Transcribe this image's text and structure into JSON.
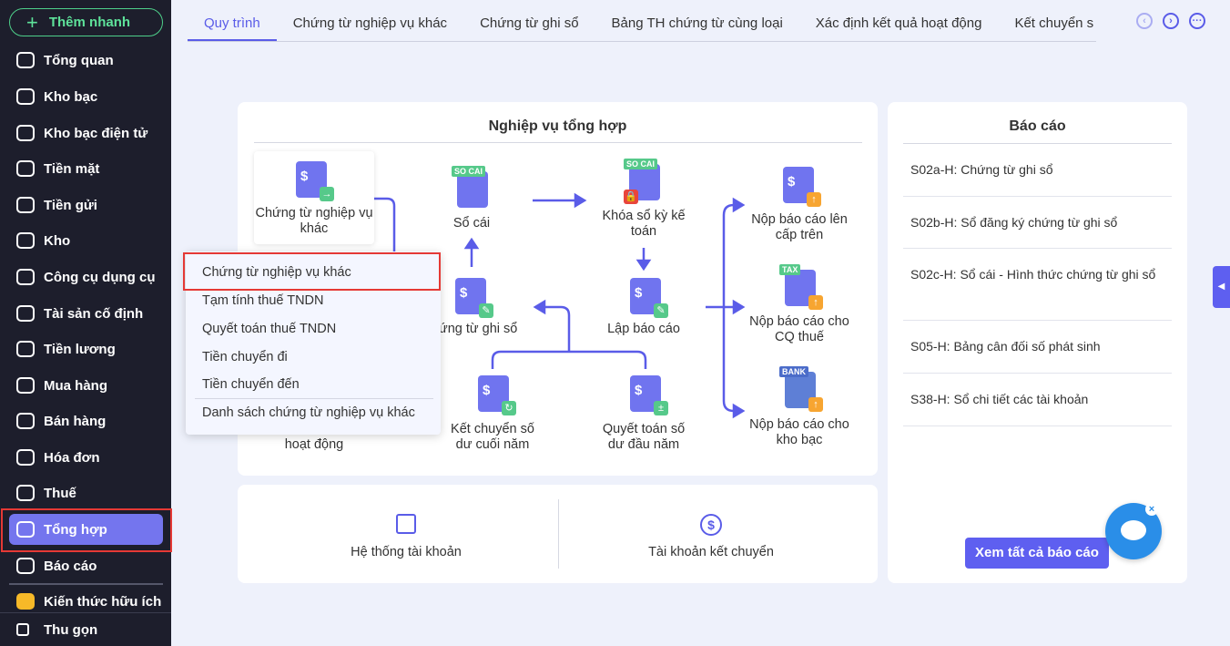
{
  "sidebar": {
    "quick_add": "Thêm nhanh",
    "items": [
      {
        "label": "Tổng quan"
      },
      {
        "label": "Kho bạc"
      },
      {
        "label": "Kho bạc điện tử"
      },
      {
        "label": "Tiền mặt"
      },
      {
        "label": "Tiền gửi"
      },
      {
        "label": "Kho"
      },
      {
        "label": "Công cụ dụng cụ"
      },
      {
        "label": "Tài sản cố định"
      },
      {
        "label": "Tiền lương"
      },
      {
        "label": "Mua hàng"
      },
      {
        "label": "Bán hàng"
      },
      {
        "label": "Hóa đơn"
      },
      {
        "label": "Thuế"
      },
      {
        "label": "Tổng hợp",
        "active": true
      },
      {
        "label": "Báo cáo"
      }
    ],
    "knowledge": "Kiến thức hữu ích",
    "collapse": "Thu gọn"
  },
  "tabs": [
    {
      "label": "Quy trình",
      "active": true
    },
    {
      "label": "Chứng từ nghiệp vụ khác"
    },
    {
      "label": "Chứng từ ghi sổ"
    },
    {
      "label": "Bảng TH chứng từ cùng loại"
    },
    {
      "label": "Xác định kết quả hoạt động"
    },
    {
      "label": "Kết chuyển s"
    }
  ],
  "process": {
    "title": "Nghiệp vụ tổng hợp",
    "nodes": {
      "ctnvk": "Chứng từ nghiệp vụ khác",
      "socai": "Sổ cái",
      "khoaso": "Khóa sổ kỳ kế toán",
      "noplen": "Nộp báo cáo lên cấp trên",
      "ctgs": "ứng từ ghi sổ",
      "lapbc": "Lập báo cáo",
      "nopthue": "Nộp báo cáo cho CQ thuế",
      "ketchuyen": "Kết chuyển số dư cuối năm",
      "quyettoan": "Quyết toán số dư đầu năm",
      "nopkb": "Nộp báo cáo cho kho bạc",
      "xdkq": "hoạt động"
    },
    "badges": {
      "socai": "SO CAI",
      "tax": "TAX",
      "bank": "BANK"
    }
  },
  "dropdown": {
    "items": [
      "Chứng từ nghiệp vụ khác",
      "Tạm tính thuế TNDN",
      "Quyết toán thuế TNDN",
      "Tiền chuyển đi",
      "Tiền chuyển đến"
    ],
    "footer": "Danh sách chứng từ nghiệp vụ khác"
  },
  "shortcuts": {
    "accounts": "Hệ thống tài khoản",
    "transfer": "Tài khoản kết chuyển"
  },
  "reports": {
    "title": "Báo cáo",
    "items": [
      "S02a-H: Chứng từ ghi sổ",
      "S02b-H: Sổ đăng ký chứng từ ghi sổ",
      "S02c-H: Sổ cái - Hình thức chứng từ ghi sổ",
      "S05-H: Bảng cân đối số phát sinh",
      "S38-H: Sổ chi tiết các tài khoản"
    ],
    "view_all": "Xem tất cả báo cáo"
  },
  "colors": {
    "accent": "#5e5ff0",
    "sidebar": "#1d1e2c",
    "highlight": "#e53935"
  }
}
